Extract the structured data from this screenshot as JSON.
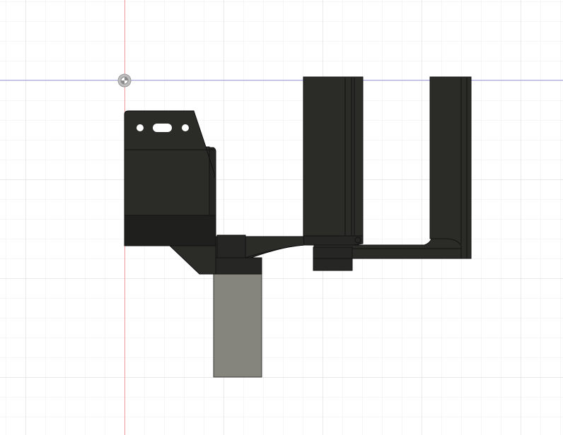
{
  "viewport": {
    "view": "front",
    "background": "#ffffff",
    "grid_minor_color": "#ebebeb",
    "grid_major_color": "#cfcfcf",
    "axis_colors": {
      "vertical_axis": "#f08c8c",
      "horizontal_axis": "#9a9ae0"
    },
    "origin_marker": "origin-point-icon"
  },
  "model": {
    "body_color": "#2b2b28",
    "body_shade_color": "#1f1f1d",
    "edge_color": "#111111",
    "selected_part_color": "#85847d",
    "parts": [
      "mounting-bracket",
      "arm-link",
      "fork-post-left",
      "fork-post-right",
      "shaft-block"
    ]
  }
}
